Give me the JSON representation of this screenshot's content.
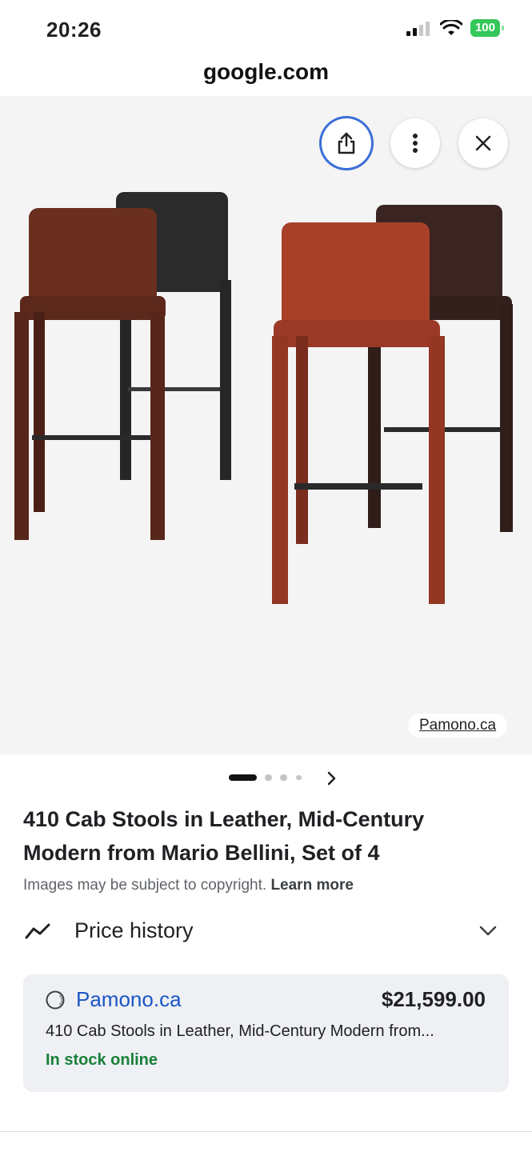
{
  "status_bar": {
    "time": "20:26",
    "battery": "100"
  },
  "browser": {
    "url": "google.com"
  },
  "image_viewer": {
    "source_chip": "Pamono.ca",
    "buttons": {
      "share": "share-icon",
      "more": "more-vertical-icon",
      "close": "close-icon"
    }
  },
  "carousel": {
    "total_dots": 4,
    "active_index": 0
  },
  "product": {
    "title": "410 Cab Stools in Leather, Mid-Century Modern from Mario Bellini, Set of 4",
    "copyright_text": "Images may be subject to copyright.",
    "learn_more": "Learn more"
  },
  "price_history": {
    "label": "Price history"
  },
  "offer": {
    "seller": "Pamono.ca",
    "price": "$21,599.00",
    "description": "410 Cab Stools in Leather, Mid-Century Modern from...",
    "stock": "In stock online"
  },
  "colors": {
    "link_blue": "#1a56c4",
    "stock_green": "#188038",
    "battery_green": "#34c759",
    "focus_ring": "#3b6fd8"
  }
}
